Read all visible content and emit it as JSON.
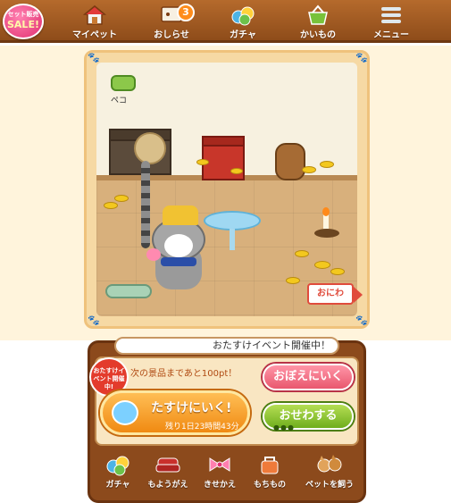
{
  "top_nav": {
    "sale_badge": {
      "line1": "セット販売",
      "line2": "SALE!"
    },
    "items": [
      {
        "label": "マイペット",
        "icon": "house-icon"
      },
      {
        "label": "おしらせ",
        "icon": "notice-icon",
        "badge": "3"
      },
      {
        "label": "ガチャ",
        "icon": "gacha-icon"
      },
      {
        "label": "かいもの",
        "icon": "basket-icon"
      },
      {
        "label": "メニュー",
        "icon": "menu-icon"
      }
    ]
  },
  "room": {
    "peko_label": "ペコ",
    "oniwa_label": "おにわ"
  },
  "event": {
    "speech": "おたすけイベント開催中！",
    "badge": "おたすけイベント開催中!",
    "next_prize": "次の景品まであと100pt！",
    "help_button": "たすけにいく!",
    "remaining": "残り1日23時間43分",
    "remember_button": "おぼえにいく",
    "care_button": "おせわする",
    "care_dots": "●●●"
  },
  "bottom_nav": {
    "items": [
      {
        "label": "ガチャ",
        "icon": "gacha-balls-icon"
      },
      {
        "label": "もようがえ",
        "icon": "sofa-icon"
      },
      {
        "label": "きせかえ",
        "icon": "ribbon-icon"
      },
      {
        "label": "もちもの",
        "icon": "bag-icon"
      },
      {
        "label": "ペットを飼う",
        "icon": "pets-icon"
      }
    ]
  },
  "colors": {
    "nav_brown": "#a85e24",
    "accent_pink": "#e9576e",
    "accent_green": "#6fae1d",
    "accent_orange": "#f08a12"
  }
}
